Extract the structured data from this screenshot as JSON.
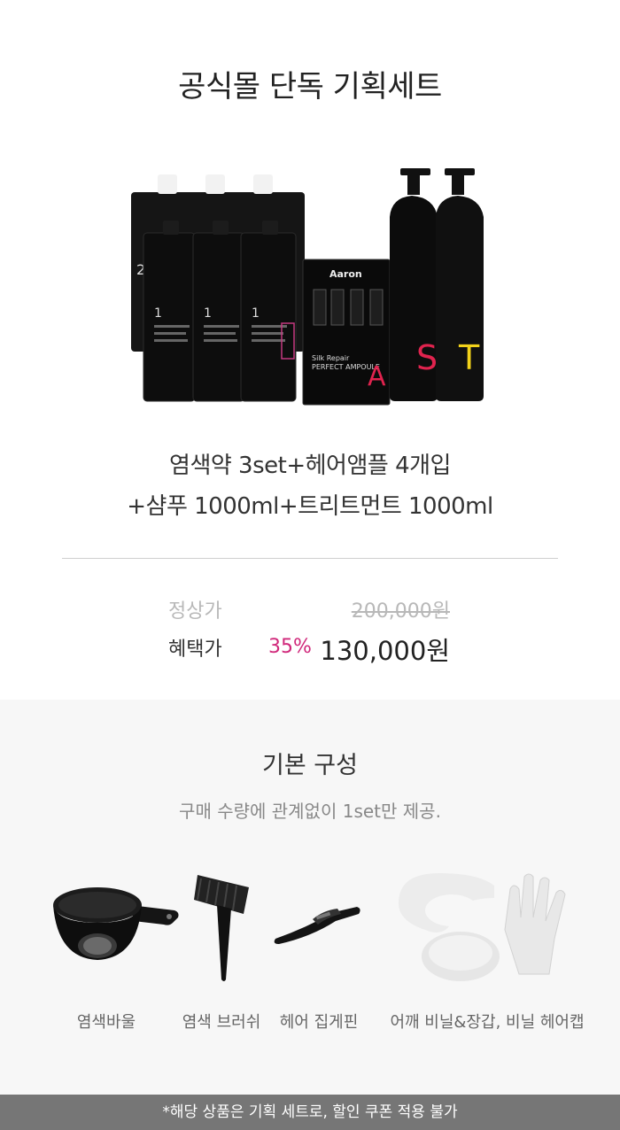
{
  "header": {
    "title": "공식몰 단독 기획세트"
  },
  "product": {
    "desc_line1": "염색약 3set+헤어앰플 4개입",
    "desc_line2": "+샴푸 1000ml+트리트먼트 1000ml",
    "pouch_number": "1",
    "pouch_tag": "염모제",
    "pouch_text": "SILK REPAIR\nTREATMENT\nCOLOR CREAM",
    "ampoule_brand": "Aaron",
    "ampoule_name_1": "Silk Repair",
    "ampoule_name_2": "PERFECT AMPOULE",
    "ampoule_letter": "A",
    "shampoo_letter": "S",
    "treatment_letter": "T",
    "back_pouch_number": "2"
  },
  "price": {
    "normal_label": "정상가",
    "normal_amount": "200,000원",
    "sale_label": "혜택가",
    "discount": "35%",
    "sale_amount": "130,000원"
  },
  "basic": {
    "title": "기본 구성",
    "desc": "구매 수량에 관계없이 1set만 제공.",
    "items": [
      {
        "label": "염색바울",
        "icon": "dye-bowl-icon"
      },
      {
        "label": "염색 브러쉬",
        "icon": "dye-brush-icon"
      },
      {
        "label": "헤어 집게핀",
        "icon": "hair-clip-icon"
      },
      {
        "label": "어깨 비닐&장갑, 비닐 헤어캡",
        "icon": "cape-gloves-cap-icon"
      }
    ]
  },
  "footer": {
    "notice": "*해당 상품은 기획 세트로, 할인 쿠폰 적용 불가"
  },
  "colors": {
    "discount": "#d0277a",
    "footer_bg": "#767676",
    "section_bg": "#f7f7f7",
    "ampoule_accent": "#e0234e",
    "shampoo_accent": "#e0234e",
    "treatment_accent": "#f2d21a"
  }
}
